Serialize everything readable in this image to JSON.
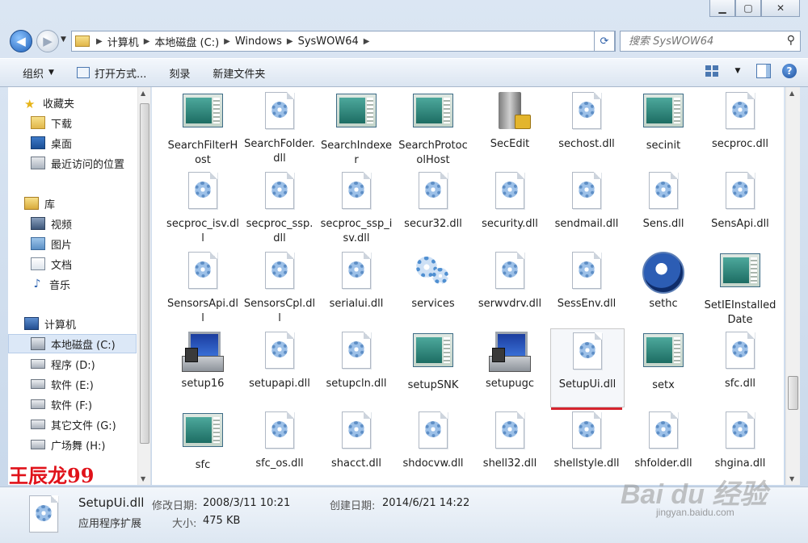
{
  "window": {
    "min_label": "▁",
    "max_label": "▢",
    "close_label": "✕"
  },
  "address": {
    "crumbs": [
      "计算机",
      "本地磁盘 (C:)",
      "Windows",
      "SysWOW64"
    ],
    "search_placeholder": "搜索 SysWOW64"
  },
  "toolbar": {
    "organize": "组织",
    "open_with": "打开方式...",
    "burn": "刻录",
    "new_folder": "新建文件夹"
  },
  "nav": {
    "favorites": "收藏夹",
    "downloads": "下载",
    "desktop": "桌面",
    "recent": "最近访问的位置",
    "libraries": "库",
    "videos": "视频",
    "pictures": "图片",
    "documents": "文档",
    "music": "音乐",
    "computer": "计算机",
    "drive_c": "本地磁盘 (C:)",
    "drive_d": "程序 (D:)",
    "drive_e": "软件 (E:)",
    "drive_f": "软件 (F:)",
    "drive_g": "其它文件 (G:)",
    "drive_h": "广场舞 (H:)"
  },
  "files": [
    {
      "name": "SearchFilterHost",
      "icon": "exe-window-icon"
    },
    {
      "name": "SearchFolder.dll",
      "icon": "dll-gear-icon"
    },
    {
      "name": "SearchIndexer",
      "icon": "exe-window-icon"
    },
    {
      "name": "SearchProtocolHost",
      "icon": "exe-window-icon"
    },
    {
      "name": "SecEdit",
      "icon": "server-lock-icon"
    },
    {
      "name": "sechost.dll",
      "icon": "dll-gear-icon"
    },
    {
      "name": "secinit",
      "icon": "exe-window-icon"
    },
    {
      "name": "secproc.dll",
      "icon": "dll-gear-icon"
    },
    {
      "name": "secproc_isv.dll",
      "icon": "dll-gear-icon"
    },
    {
      "name": "secproc_ssp.dll",
      "icon": "dll-gear-icon"
    },
    {
      "name": "secproc_ssp_isv.dll",
      "icon": "dll-gear-icon"
    },
    {
      "name": "secur32.dll",
      "icon": "dll-gear-icon"
    },
    {
      "name": "security.dll",
      "icon": "dll-gear-icon"
    },
    {
      "name": "sendmail.dll",
      "icon": "dll-gear-icon"
    },
    {
      "name": "Sens.dll",
      "icon": "dll-gear-icon"
    },
    {
      "name": "SensApi.dll",
      "icon": "dll-gear-icon"
    },
    {
      "name": "SensorsApi.dll",
      "icon": "dll-gear-icon"
    },
    {
      "name": "SensorsCpl.dll",
      "icon": "dll-gear-icon"
    },
    {
      "name": "serialui.dll",
      "icon": "dll-gear-icon"
    },
    {
      "name": "services",
      "icon": "services-gears-icon"
    },
    {
      "name": "serwvdrv.dll",
      "icon": "dll-gear-icon"
    },
    {
      "name": "SessEnv.dll",
      "icon": "dll-gear-icon"
    },
    {
      "name": "sethc",
      "icon": "sethc-icon"
    },
    {
      "name": "SetIEInstalledDate",
      "icon": "exe-window-icon"
    },
    {
      "name": "setup16",
      "icon": "setup-computer-icon"
    },
    {
      "name": "setupapi.dll",
      "icon": "dll-gear-icon"
    },
    {
      "name": "setupcln.dll",
      "icon": "dll-gear-icon"
    },
    {
      "name": "setupSNK",
      "icon": "exe-window-icon"
    },
    {
      "name": "setupugc",
      "icon": "setup-computer-icon"
    },
    {
      "name": "SetupUi.dll",
      "icon": "dll-gear-icon"
    },
    {
      "name": "setx",
      "icon": "exe-window-icon"
    },
    {
      "name": "sfc.dll",
      "icon": "dll-gear-icon"
    },
    {
      "name": "sfc",
      "icon": "exe-window-icon"
    },
    {
      "name": "sfc_os.dll",
      "icon": "dll-gear-icon"
    },
    {
      "name": "shacct.dll",
      "icon": "dll-gear-icon"
    },
    {
      "name": "shdocvw.dll",
      "icon": "dll-gear-icon"
    },
    {
      "name": "shell32.dll",
      "icon": "dll-gear-icon"
    },
    {
      "name": "shellstyle.dll",
      "icon": "dll-gear-icon"
    },
    {
      "name": "shfolder.dll",
      "icon": "dll-gear-icon"
    },
    {
      "name": "shgina.dll",
      "icon": "dll-gear-icon"
    }
  ],
  "selected_file": "SetupUi.dll",
  "details": {
    "name": "SetupUi.dll",
    "type": "应用程序扩展",
    "modified_label": "修改日期:",
    "modified_value": "2008/3/11 10:21",
    "created_label": "创建日期:",
    "created_value": "2014/6/21 14:22",
    "size_label": "大小:",
    "size_value": "475 KB"
  },
  "overlays": {
    "author_watermark": "王辰龙99",
    "baidu_logo": "Bai du 经验",
    "baidu_url": "jingyan.baidu.com"
  },
  "colors": {
    "selection_underline": "#d6242e",
    "watermark_red": "#e0121a"
  }
}
